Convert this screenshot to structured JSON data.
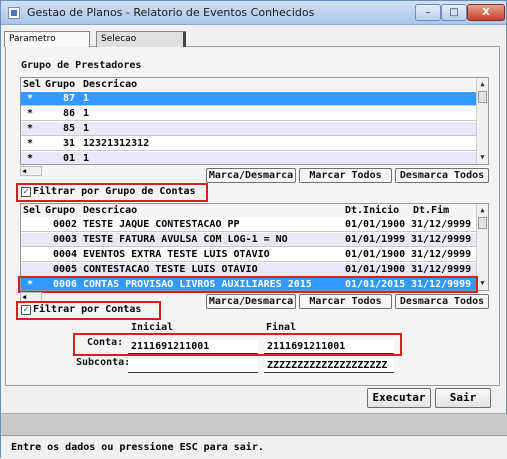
{
  "window": {
    "title": "Gestao de Planos - Relatorio de Eventos Conhecidos",
    "min_glyph": "–",
    "max_glyph": "□",
    "close_glyph": "X"
  },
  "tabs": [
    "Parametro",
    "Selecao"
  ],
  "prestadores": {
    "label": "Grupo de Prestadores",
    "headers": [
      "Sel",
      "Grupo",
      "Descricao"
    ],
    "rows": [
      {
        "sel": "*",
        "grupo": "87",
        "descricao": "1"
      },
      {
        "sel": "*",
        "grupo": "86",
        "descricao": "1"
      },
      {
        "sel": "*",
        "grupo": "85",
        "descricao": "1"
      },
      {
        "sel": "*",
        "grupo": "31",
        "descricao": "12321312312"
      },
      {
        "sel": "*",
        "grupo": "01",
        "descricao": "1"
      }
    ]
  },
  "buttons_row1": {
    "marca_desmarca": "Marca/Desmarca",
    "marcar_todos": "Marcar Todos",
    "desmarca_todos": "Desmarca Todos"
  },
  "filter_grupo": {
    "checked": "✓",
    "label": "Filtrar por Grupo de Contas"
  },
  "contas": {
    "headers": [
      "Sel",
      "Grupo",
      "Descricao",
      "Dt.Inicio",
      "Dt.Fim"
    ],
    "rows": [
      {
        "sel": "",
        "grupo": "0002",
        "descricao": "TESTE JAQUE CONTESTACAO PP",
        "inicio": "01/01/1900",
        "fim": "31/12/9999"
      },
      {
        "sel": "",
        "grupo": "0003",
        "descricao": "TESTE FATURA AVULSA COM LOG-1 = NO",
        "inicio": "01/01/1999",
        "fim": "31/12/9999"
      },
      {
        "sel": "",
        "grupo": "0004",
        "descricao": "EVENTOS EXTRA TESTE LUIS OTAVIO",
        "inicio": "01/01/1900",
        "fim": "31/12/9999"
      },
      {
        "sel": "",
        "grupo": "0005",
        "descricao": "CONTESTACAO TESTE LUIS OTAVIO",
        "inicio": "01/01/1900",
        "fim": "31/12/9999"
      },
      {
        "sel": "*",
        "grupo": "0006",
        "descricao": "CONTAS PROVISAO LIVROS AUXILIARES 2015",
        "inicio": "01/01/2015",
        "fim": "31/12/9999"
      }
    ]
  },
  "buttons_row2": {
    "marca_desmarca": "Marca/Desmarca",
    "marcar_todos": "Marcar Todos",
    "desmarca_todos": "Desmarca Todos"
  },
  "filter_contas": {
    "checked": "✓",
    "label": "Filtrar por Contas"
  },
  "range": {
    "inicial_label": "Inicial",
    "final_label": "Final",
    "conta_label": "Conta:",
    "conta_inicial": "2111691211001",
    "conta_final": "2111691211001",
    "subconta_label": "Subconta:",
    "subconta_inicial": "",
    "subconta_final": "ZZZZZZZZZZZZZZZZZZZZ"
  },
  "actions": {
    "executar": "Executar",
    "sair": "Sair"
  },
  "status_text": "Entre os dados ou pressione ESC para sair."
}
